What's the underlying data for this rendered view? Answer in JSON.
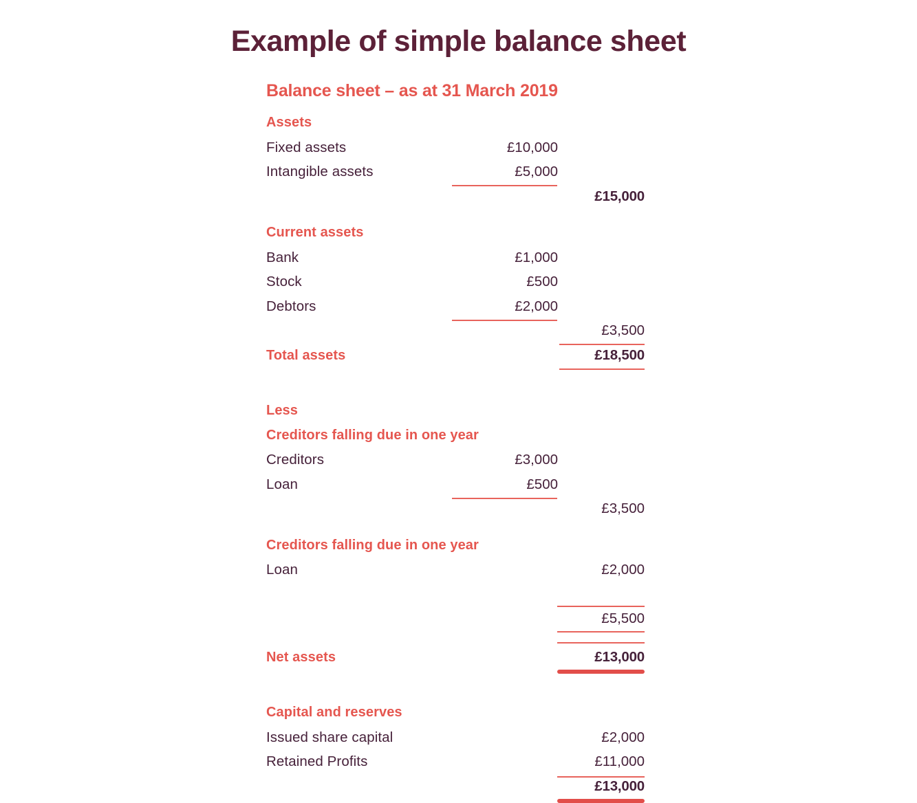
{
  "page": {
    "title": "Example of simple balance sheet",
    "colors": {
      "title_maroon": "#5C2138",
      "accent_red": "#E5564F",
      "rule_red": "#E8635C",
      "rule_thick_red": "#E24E4A",
      "body_text": "#46213A",
      "background": "#FFFFFF"
    }
  },
  "sheet": {
    "heading": "Balance sheet – as at 31 March 2019",
    "sections": {
      "assets": {
        "heading": "Assets",
        "lines": [
          {
            "label": "Fixed assets",
            "col1": "£10,000"
          },
          {
            "label": "Intangible assets",
            "col1": "£5,000"
          }
        ],
        "subtotal": "£15,000"
      },
      "current_assets": {
        "heading": "Current assets",
        "lines": [
          {
            "label": "Bank",
            "col1": "£1,000"
          },
          {
            "label": "Stock",
            "col1": "£500"
          },
          {
            "label": "Debtors",
            "col1": "£2,000"
          }
        ],
        "subtotal": "£3,500"
      },
      "total_assets": {
        "label": "Total assets",
        "value": "£18,500"
      },
      "less": {
        "heading": "Less"
      },
      "creditors_one_year_a": {
        "heading": "Creditors falling due in one year",
        "lines": [
          {
            "label": "Creditors",
            "col1": "£3,000"
          },
          {
            "label": "Loan",
            "col1": "£500"
          }
        ],
        "subtotal": "£3,500"
      },
      "creditors_one_year_b": {
        "heading": "Creditors falling due in one year",
        "lines": [
          {
            "label": "Loan",
            "col2": "£2,000"
          }
        ],
        "subtotal": "£5,500"
      },
      "net_assets": {
        "label": "Net assets",
        "value": "£13,000"
      },
      "capital_and_reserves": {
        "heading": "Capital and reserves",
        "lines": [
          {
            "label": "Issued share capital",
            "col2": "£2,000"
          },
          {
            "label": "Retained Profits",
            "col2": "£11,000"
          }
        ],
        "total": "£13,000"
      }
    }
  }
}
